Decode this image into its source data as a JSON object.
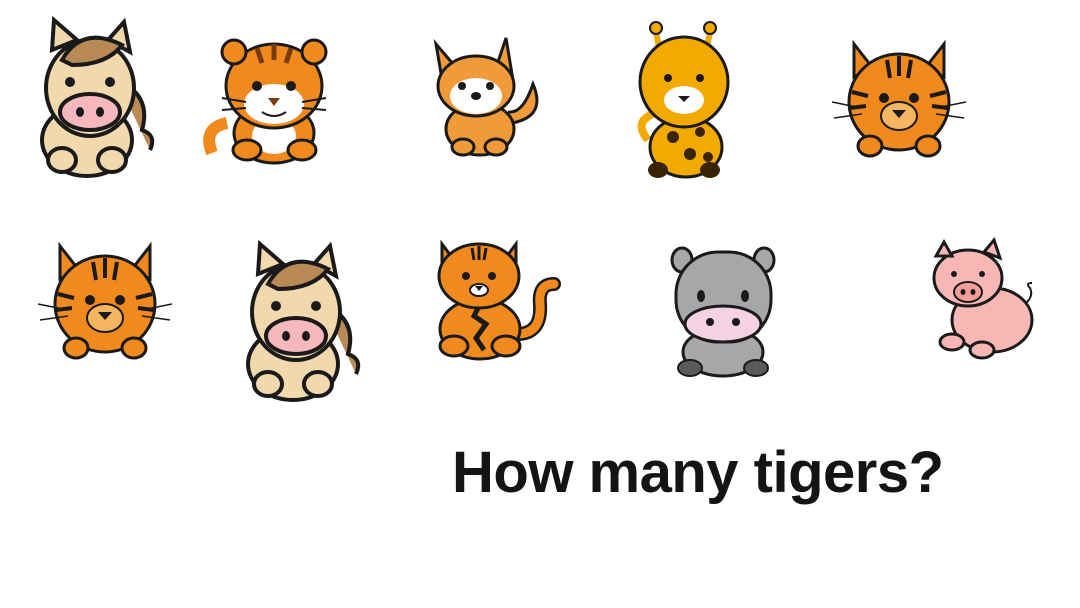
{
  "question": "How many tigers?",
  "animals": [
    {
      "row": 1,
      "kind": "horse",
      "icon": "horse-icon"
    },
    {
      "row": 1,
      "kind": "tiger",
      "icon": "tiger-icon"
    },
    {
      "row": 1,
      "kind": "fox",
      "icon": "fox-icon"
    },
    {
      "row": 1,
      "kind": "giraffe",
      "icon": "giraffe-icon"
    },
    {
      "row": 1,
      "kind": "tiger",
      "icon": "tiger-icon"
    },
    {
      "row": 2,
      "kind": "tiger",
      "icon": "tiger-icon"
    },
    {
      "row": 2,
      "kind": "horse",
      "icon": "horse-icon"
    },
    {
      "row": 2,
      "kind": "tiger",
      "icon": "tiger-icon"
    },
    {
      "row": 2,
      "kind": "rhino",
      "icon": "rhino-icon"
    },
    {
      "row": 2,
      "kind": "pig",
      "icon": "pig-icon"
    }
  ],
  "colors": {
    "tiger": "#f08a1e",
    "horse": "#f2d9ad",
    "mane": "#b98a55",
    "fox": "#f09a3a",
    "giraffe": "#f2a900",
    "rhino": "#a7a7a7",
    "pig": "#f7b8b5",
    "outline": "#1a1a1a",
    "text": "#141414"
  }
}
